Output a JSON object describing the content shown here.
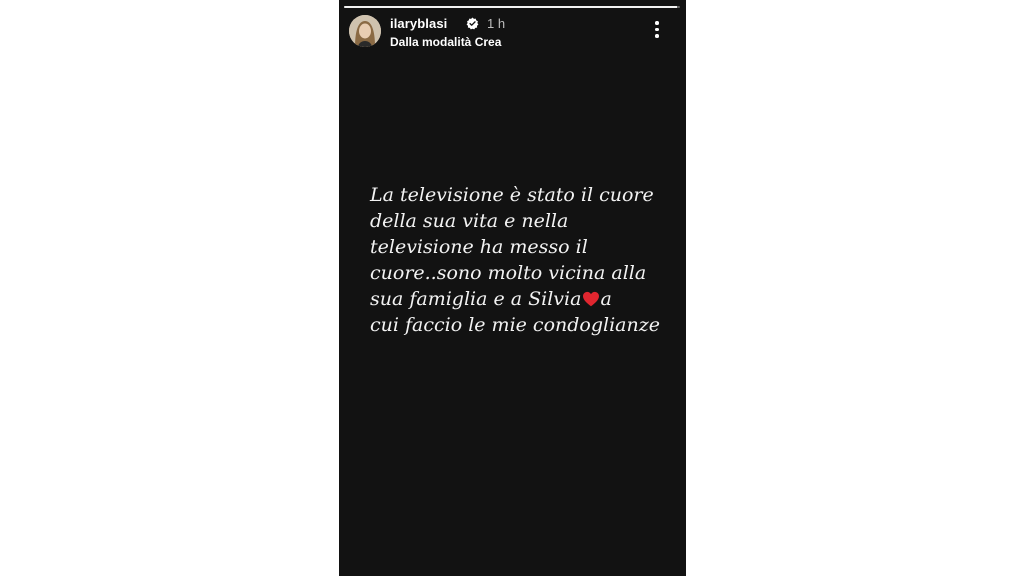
{
  "story": {
    "progress": 0.99,
    "header": {
      "username": "ilaryblasi",
      "verified": true,
      "time": "1 h",
      "subtitle": "Dalla modalità Crea"
    },
    "message_lines": [
      "La televisione è stato il cuore",
      "della sua vita e nella",
      "televisione ha messo il",
      "cuore..sono molto vicina alla",
      "sua famiglia e a Silvia",
      "cui faccio le mie condoglianze"
    ],
    "heart_after_line": 5,
    "heart_suffix": "a",
    "colors": {
      "background": "#121212",
      "text": "#f2f2f2",
      "heart": "#e0262f"
    },
    "icons": {
      "verified": "verified-badge-icon",
      "more": "more-vertical-icon",
      "heart": "red-heart-icon"
    }
  }
}
